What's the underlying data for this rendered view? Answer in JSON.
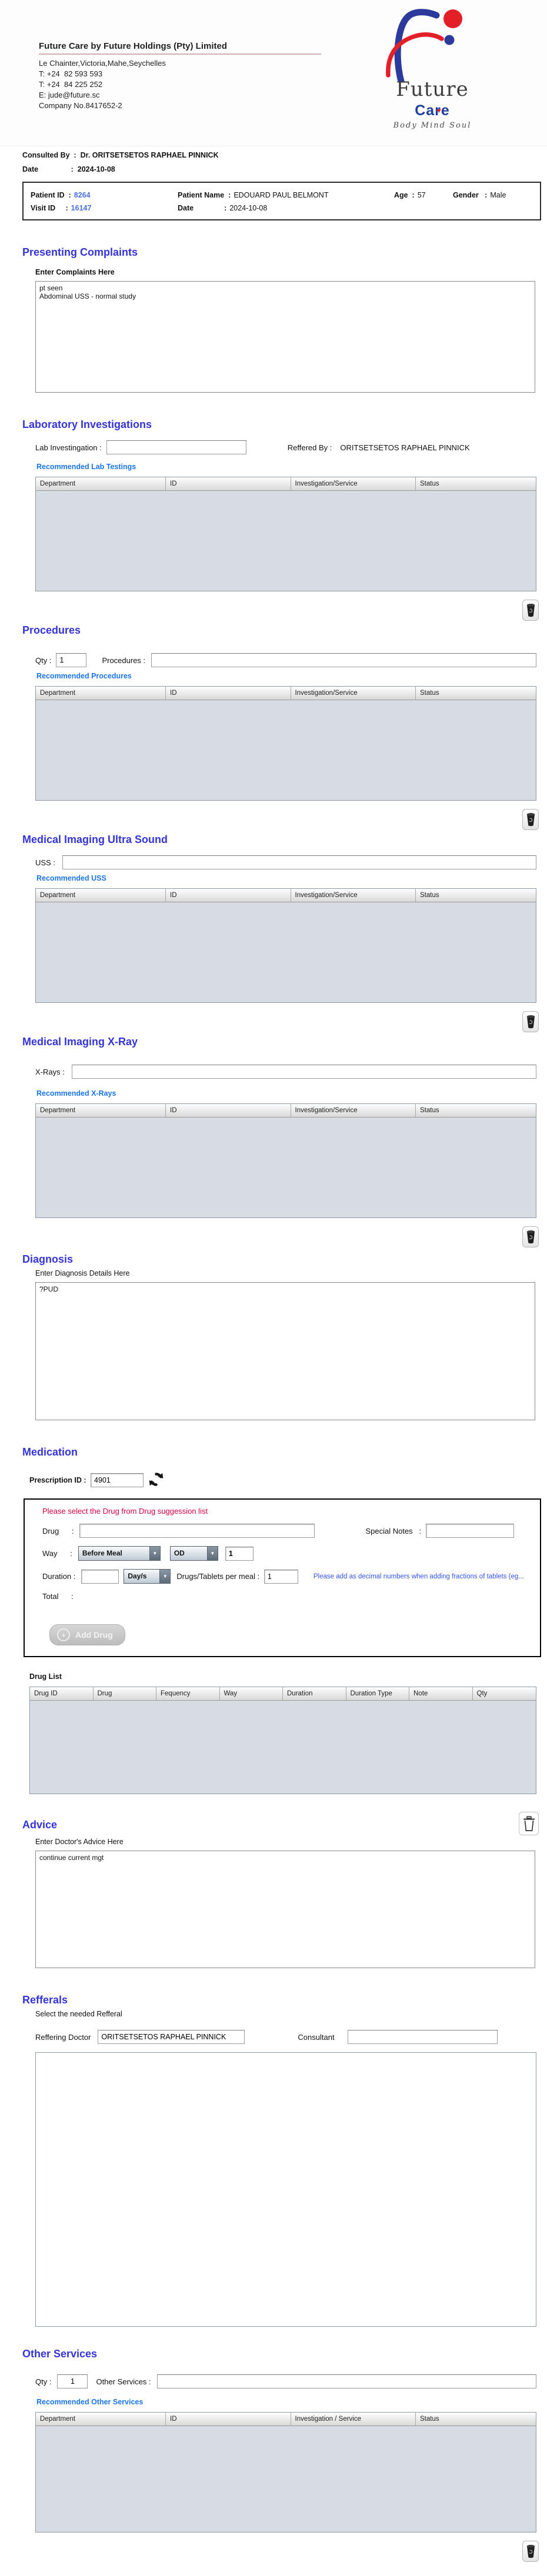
{
  "colors": {
    "section_title_blue": "#3434d8",
    "link_blue": "#1b74e8",
    "value_blue": "#4a6fdc",
    "note_red": "#d40040",
    "note_blue": "#3355e6",
    "logo_blue": "#2b3a9b",
    "logo_red": "#e32028",
    "table_body_gray": "#d7dbe2"
  },
  "icons": {
    "dropdown_arrow": "▼",
    "plus": "+",
    "heart": "♥"
  },
  "header": {
    "company_name": "Future Care by Future Holdings (Pty) Limited",
    "address": "Le Chainter,Victoria,Mahe,Seychelles",
    "phone1": "T: +24  82 593 593",
    "phone2": "T: +24  84 225 252",
    "email": "E: jude@future.sc",
    "company_no": "Company No.8417652-2",
    "logo": {
      "word1": "Future",
      "word2": "Care",
      "tagline": "Body Mind Soul"
    }
  },
  "consult": {
    "consulted_label": "Consulted By  :  ",
    "consulted_value": "Dr.  ORITSETSETOS RAPHAEL PINNICK",
    "date_label": "Date                :  ",
    "date_value": "2024-10-08"
  },
  "patient": {
    "id_label": "Patient ID  :",
    "id_value": "8264",
    "name_label": "Patient Name  :",
    "name_value": "EDOUARD PAUL BELMONT",
    "age_label": "Age  :",
    "age_value": "57",
    "gender_label": "Gender   :",
    "gender_value": "Male",
    "visit_label": "Visit ID     :",
    "visit_value": "16147",
    "date_label": "Date               :",
    "date_value": "2024-10-08"
  },
  "complaints": {
    "title": "Presenting Complaints",
    "label": "Enter Complaints Here",
    "value": "pt seen\nAbdominal USS - normal study"
  },
  "lab": {
    "title": "Laboratory  Investigations",
    "input_label": "Lab Investingation :",
    "input_value": "",
    "referred_label": "Reffered By :",
    "referred_value": "ORITSETSETOS RAPHAEL PINNICK",
    "recommended": "Recommended Lab Testings",
    "columns": [
      "Department",
      "ID",
      "Investigation/Service",
      "Status"
    ],
    "rows": []
  },
  "procedures": {
    "title": "Procedures",
    "qty_label": "Qty :",
    "qty_value": "1",
    "input_label": "Procedures :",
    "input_value": "",
    "recommended": "Recommended Procedures",
    "columns": [
      "Department",
      "ID",
      "Investigation/Service",
      "Status"
    ],
    "rows": []
  },
  "uss": {
    "title": "Medical Imaging Ultra Sound",
    "input_label": "USS :",
    "input_value": "",
    "recommended": "Recommended USS",
    "columns": [
      "Department",
      "ID",
      "Investigation/Service",
      "Status"
    ],
    "rows": []
  },
  "xray": {
    "title": "Medical Imaging X-Ray",
    "input_label": "X-Rays :",
    "input_value": "",
    "recommended": "Recommended X-Rays",
    "columns": [
      "Department",
      "ID",
      "Investigation/Service",
      "Status"
    ],
    "rows": []
  },
  "diagnosis": {
    "title": "Diagnosis",
    "label": "Enter Diagnosis Details Here",
    "value": "?PUD"
  },
  "medication": {
    "title": "Medication",
    "rx_label": "Prescription ID : ",
    "rx_value": "4901",
    "note_red": "Please select the Drug from Drug suggession list",
    "drug_label": "Drug      :",
    "drug_value": "",
    "special_label": "Special Notes   :",
    "special_value": "",
    "way_label": "Way      :",
    "meal_option": "Before Meal",
    "freq_option": "OD",
    "freq_qty": "1",
    "duration_label": "Duration :",
    "duration_value": "",
    "duration_unit": "Day/s",
    "per_meal_label": "Drugs/Tablets per meal : ",
    "per_meal_value": "1",
    "note_blue": "Please add as decimal numbers when adding fractions of tablets (eg...",
    "total_label": "Total      :",
    "add_drug": "Add Drug",
    "drug_list_label": "Drug List",
    "columns": [
      "Drug ID",
      "Drug",
      "Fequency",
      "Way",
      "Duration",
      "Duration Type",
      "Note",
      "Qty"
    ],
    "rows": []
  },
  "advice": {
    "title": "Advice",
    "label": "Enter Doctor's Advice Here",
    "value": "continue current mgt"
  },
  "referrals": {
    "title": "Refferals",
    "subtitle": "Select the needed Refferal",
    "doctor_label": "Reffering Doctor",
    "doctor_value": "ORITSETSETOS RAPHAEL PINNICK",
    "consultant_label": "Consultant",
    "consultant_value": ""
  },
  "other": {
    "title": "Other Services",
    "qty_label": "Qty :",
    "qty_value": "1",
    "input_label": "Other Services :",
    "input_value": "",
    "recommended": "Recommended Other Services",
    "columns": [
      "Department",
      "ID",
      "Investigation / Service",
      "Status"
    ],
    "rows": []
  }
}
